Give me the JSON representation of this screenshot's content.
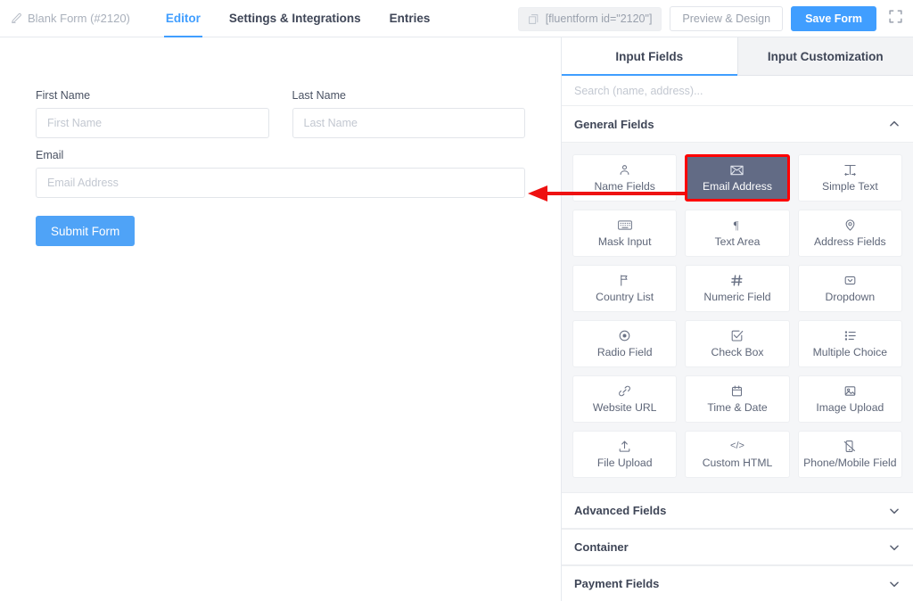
{
  "topbar": {
    "form_name": "Blank Form (#2120)",
    "pencil_icon": "pencil-icon",
    "tabs": [
      {
        "label": "Editor",
        "active": true
      },
      {
        "label": "Settings & Integrations",
        "active": false
      },
      {
        "label": "Entries",
        "active": false
      }
    ],
    "shortcode": "[fluentform id=\"2120\"]",
    "copy_icon": "copy-icon",
    "preview_button": "Preview & Design",
    "save_button": "Save Form",
    "fullscreen_icon": "fullscreen-icon"
  },
  "canvas": {
    "fields": [
      {
        "label": "First Name",
        "placeholder": "First Name",
        "name": "first-name"
      },
      {
        "label": "Last Name",
        "placeholder": "Last Name",
        "name": "last-name"
      },
      {
        "label": "Email",
        "placeholder": "Email Address",
        "name": "email"
      }
    ],
    "submit_label": "Submit Form"
  },
  "panel": {
    "tabs": [
      {
        "label": "Input Fields",
        "active": true
      },
      {
        "label": "Input Customization",
        "active": false
      }
    ],
    "search_placeholder": "Search (name, address)...",
    "general_fields": {
      "title": "General Fields",
      "expanded": true,
      "chevron": "chevron-up-icon",
      "tiles": [
        {
          "label": "Name Fields",
          "icon": "user-icon",
          "glyph": "person",
          "selected": false
        },
        {
          "label": "Email Address",
          "icon": "envelope-icon",
          "glyph": "envelope",
          "selected": true
        },
        {
          "label": "Simple Text",
          "icon": "text-width-icon",
          "glyph": "textwidth",
          "selected": false
        },
        {
          "label": "Mask Input",
          "icon": "keyboard-icon",
          "glyph": "keyboard",
          "selected": false
        },
        {
          "label": "Text Area",
          "icon": "paragraph-icon",
          "glyph": "paragraph",
          "selected": false
        },
        {
          "label": "Address Fields",
          "icon": "map-pin-icon",
          "glyph": "pin",
          "selected": false
        },
        {
          "label": "Country List",
          "icon": "flag-icon",
          "glyph": "flag",
          "selected": false
        },
        {
          "label": "Numeric Field",
          "icon": "hash-icon",
          "glyph": "hash",
          "selected": false
        },
        {
          "label": "Dropdown",
          "icon": "dropdown-icon",
          "glyph": "dropdown",
          "selected": false
        },
        {
          "label": "Radio Field",
          "icon": "radio-icon",
          "glyph": "radio",
          "selected": false
        },
        {
          "label": "Check Box",
          "icon": "checkbox-icon",
          "glyph": "checkbox",
          "selected": false
        },
        {
          "label": "Multiple Choice",
          "icon": "list-icon",
          "glyph": "list",
          "selected": false
        },
        {
          "label": "Website URL",
          "icon": "link-icon",
          "glyph": "link",
          "selected": false
        },
        {
          "label": "Time & Date",
          "icon": "calendar-icon",
          "glyph": "calendar",
          "selected": false
        },
        {
          "label": "Image Upload",
          "icon": "image-icon",
          "glyph": "image",
          "selected": false
        },
        {
          "label": "File Upload",
          "icon": "upload-icon",
          "glyph": "upload",
          "selected": false
        },
        {
          "label": "Custom HTML",
          "icon": "code-icon",
          "glyph": "code",
          "selected": false
        },
        {
          "label": "Phone/Mobile Field",
          "icon": "phone-icon",
          "glyph": "phone",
          "selected": false
        }
      ]
    },
    "collapsed_sections": [
      {
        "title": "Advanced Fields",
        "chevron": "chevron-down-icon"
      },
      {
        "title": "Container",
        "chevron": "chevron-down-icon"
      },
      {
        "title": "Payment Fields",
        "chevron": "chevron-down-icon"
      }
    ]
  },
  "annotation": {
    "type": "arrow",
    "color": "#ee1111",
    "points_to": "Email Address tile",
    "direction": "left"
  },
  "colors": {
    "accent_blue": "#409eff",
    "submit_blue": "#4fa3f7",
    "selected_tile_bg": "#626b85",
    "annotation_red": "#ee1111",
    "panel_bg": "#f5f6f8"
  }
}
